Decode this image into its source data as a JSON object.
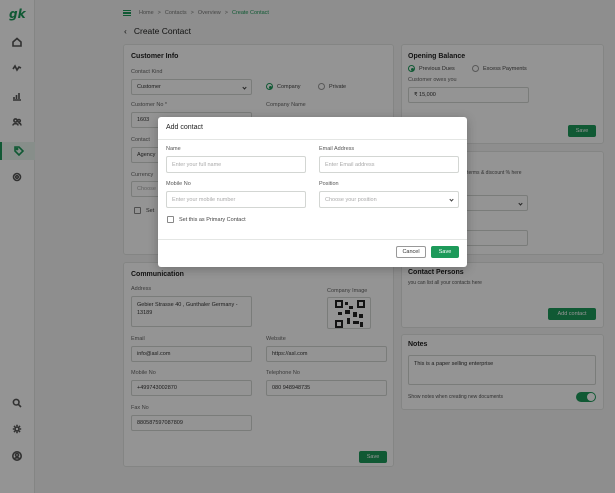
{
  "app": {
    "logo": "gk"
  },
  "breadcrumb": {
    "items": [
      "Home",
      "Contacts",
      "Overview"
    ],
    "current": "Create Contact",
    "sep": ">"
  },
  "page": {
    "title": "Create Contact"
  },
  "customer_info": {
    "title": "Customer Info",
    "contact_kind_label": "Contact Kind",
    "contact_kind_value": "Customer",
    "radio_company": "Company",
    "radio_private": "Private",
    "customer_no_label": "Customer No *",
    "customer_no_value": "1603",
    "company_name_label": "Company Name",
    "contact_label": "Contact",
    "agency_value": "Agency",
    "currency_label": "Currency",
    "choose_value": "Choose",
    "set_label": "Set"
  },
  "communication": {
    "title": "Communication",
    "address_label": "Address",
    "address_value": "Gebier Strasse 40 , Gunthaler Germany - 13189",
    "company_image_label": "Company Image",
    "email_label": "Email",
    "email_value": "info@asl.com",
    "website_label": "Website",
    "website_value": "https://asl.com",
    "mobile_label": "Mobile No",
    "mobile_value": "+499743002870",
    "telephone_label": "Telephone No",
    "telephone_value": "080 948948735",
    "fax_label": "Fax No",
    "fax_value": "880587597087809",
    "save_label": "Save"
  },
  "opening_balance": {
    "title": "Opening Balance",
    "radio_previous": "Previous Dues",
    "radio_excess": "Excess Payments",
    "owes_label": "Customer owes you",
    "owes_value": "₹ 15,000",
    "save_label": "Save"
  },
  "terms": {
    "text": "r terms & discount % here",
    "text2": "s"
  },
  "contact_persons": {
    "title": "Contact Persons",
    "subtitle": "you can list all your contacts here",
    "add_label": "Add contact"
  },
  "notes": {
    "title": "Notes",
    "value": "This is a paper selling enterprise",
    "show_label": "Show notes when creating new documents"
  },
  "modal": {
    "title": "Add contact",
    "name_label": "Name",
    "name_placeholder": "Enter your full name",
    "email_label": "Email Address",
    "email_placeholder": "Enter Email address",
    "mobile_label": "Mobile No",
    "mobile_placeholder": "Enter your mobile number",
    "position_label": "Position",
    "position_placeholder": "Choose your position",
    "primary_label": "Set this as Primary Contact",
    "cancel_label": "Cancel",
    "save_label": "Save"
  },
  "colors": {
    "accent": "#1d9a5a",
    "overlay": "rgba(0,0,0,0.42)"
  },
  "icons": {
    "sidebar": [
      "home-icon",
      "activity-icon",
      "chart-icon",
      "users-icon",
      "tag-icon",
      "settings-icon"
    ],
    "bottom": [
      "search-icon",
      "gear-icon",
      "profile-icon"
    ]
  }
}
